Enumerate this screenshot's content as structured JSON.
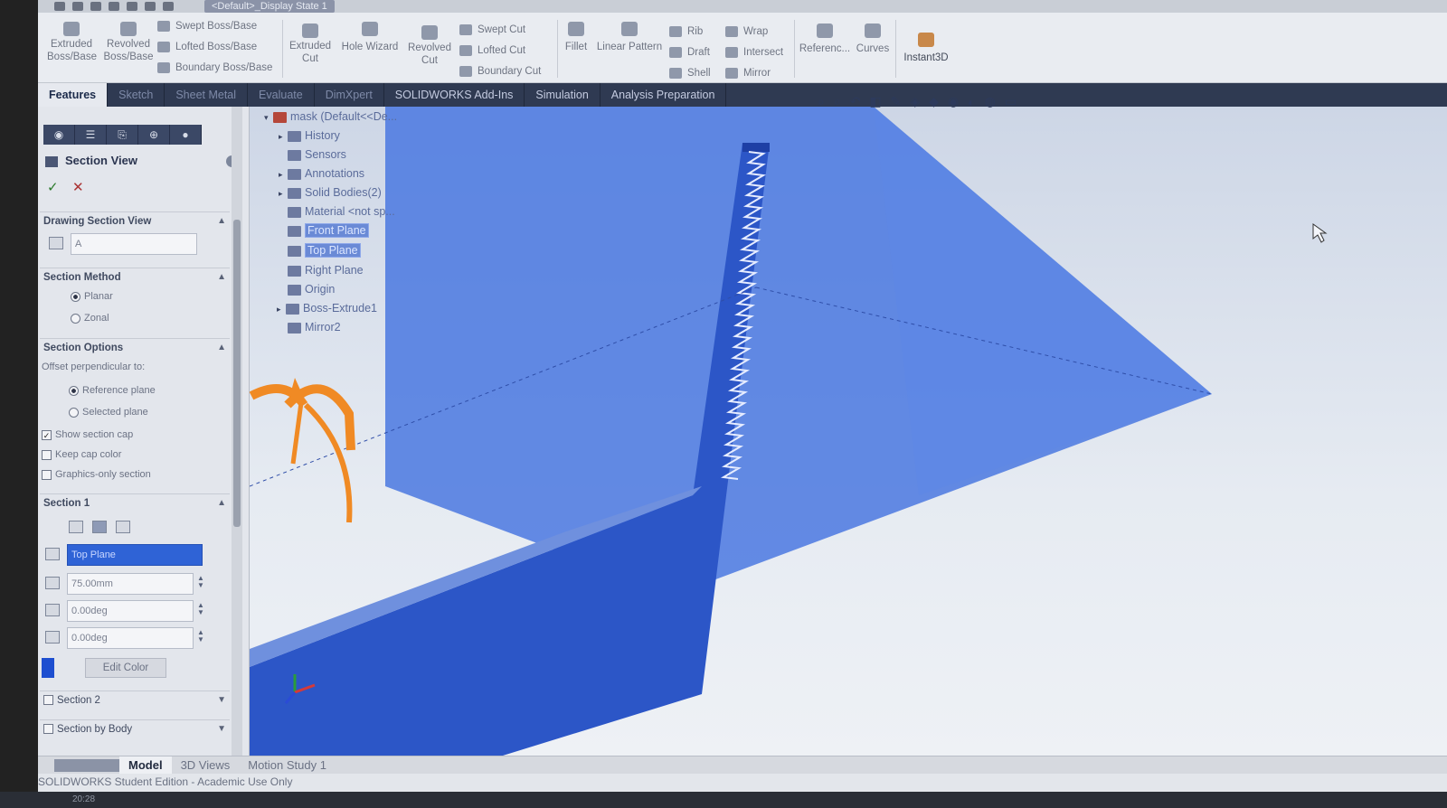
{
  "quick_access": {
    "display_state": "<Default>_Display State 1"
  },
  "ribbon": {
    "extruded_boss": "Extruded Boss/Base",
    "revolved_boss": "Revolved Boss/Base",
    "swept_boss": "Swept Boss/Base",
    "lofted_boss": "Lofted Boss/Base",
    "boundary_boss": "Boundary Boss/Base",
    "extruded_cut": "Extruded Cut",
    "hole_wizard": "Hole Wizard",
    "revolved_cut": "Revolved Cut",
    "swept_cut": "Swept Cut",
    "lofted_cut": "Lofted Cut",
    "boundary_cut": "Boundary Cut",
    "fillet": "Fillet",
    "linear_pattern": "Linear Pattern",
    "rib": "Rib",
    "draft": "Draft",
    "shell": "Shell",
    "wrap": "Wrap",
    "intersect": "Intersect",
    "mirror": "Mirror",
    "reference": "Referenc...",
    "curves": "Curves",
    "instant3d": "Instant3D"
  },
  "tabs": [
    "Features",
    "Sketch",
    "Sheet Metal",
    "Evaluate",
    "DimXpert",
    "SOLIDWORKS Add-Ins",
    "Simulation",
    "Analysis Preparation"
  ],
  "property_manager": {
    "title": "Section View",
    "drawing_section_view": {
      "heading": "Drawing Section View",
      "value": "A"
    },
    "section_method": {
      "heading": "Section Method",
      "planar": "Planar",
      "zonal": "Zonal"
    },
    "section_options": {
      "heading": "Section Options",
      "offset_label": "Offset perpendicular to:",
      "reference_plane": "Reference plane",
      "selected_plane": "Selected plane",
      "show_section_cap": "Show section cap",
      "keep_cap_color": "Keep cap color",
      "graphics_only": "Graphics-only section"
    },
    "section1": {
      "heading": "Section 1",
      "plane": "Top Plane",
      "offset": "75.00mm",
      "angle_x": "0.00deg",
      "angle_y": "0.00deg",
      "edit_color": "Edit Color"
    },
    "section2": "Section 2",
    "section_by_body": "Section by Body"
  },
  "tree": {
    "root": "mask  (Default<<De...",
    "items": [
      "History",
      "Sensors",
      "Annotations",
      "Solid Bodies(2)",
      "Material <not sp...",
      "Front Plane",
      "Top Plane",
      "Right Plane",
      "Origin",
      "Boss-Extrude1",
      "Mirror2"
    ]
  },
  "bottom_tabs": {
    "model": "Model",
    "views3d": "3D Views",
    "motion": "Motion Study 1"
  },
  "status": {
    "text": "SOLIDWORKS Student Edition - Academic Use Only"
  },
  "taskbar": {
    "time": "20:28"
  },
  "colors": {
    "section_plane": "#4a78e0",
    "part_body": "#2c56c7",
    "manipulator": "#f08a24"
  }
}
